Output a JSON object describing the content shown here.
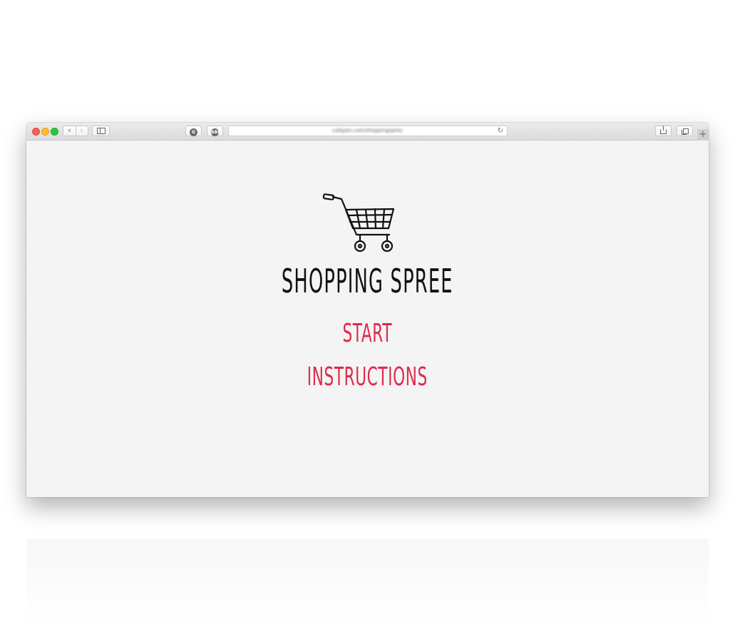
{
  "browser": {
    "url": "callgam.com/shoppingspree",
    "nav_back_icon": "chevron-left-icon",
    "nav_forward_icon": "chevron-right-icon",
    "reload_icon": "reload-icon",
    "extension_1_label": "G",
    "extension_2_label": "ABP",
    "new_tab_label": "+"
  },
  "game": {
    "title": "SHOPPING SPREE",
    "logo_icon": "shopping-cart-icon",
    "menu": {
      "start": "START",
      "instructions": "INSTRUCTIONS"
    }
  },
  "colors": {
    "title": "#111111",
    "menu_link": "#e0294a",
    "page_background": "#f7f7f7"
  }
}
